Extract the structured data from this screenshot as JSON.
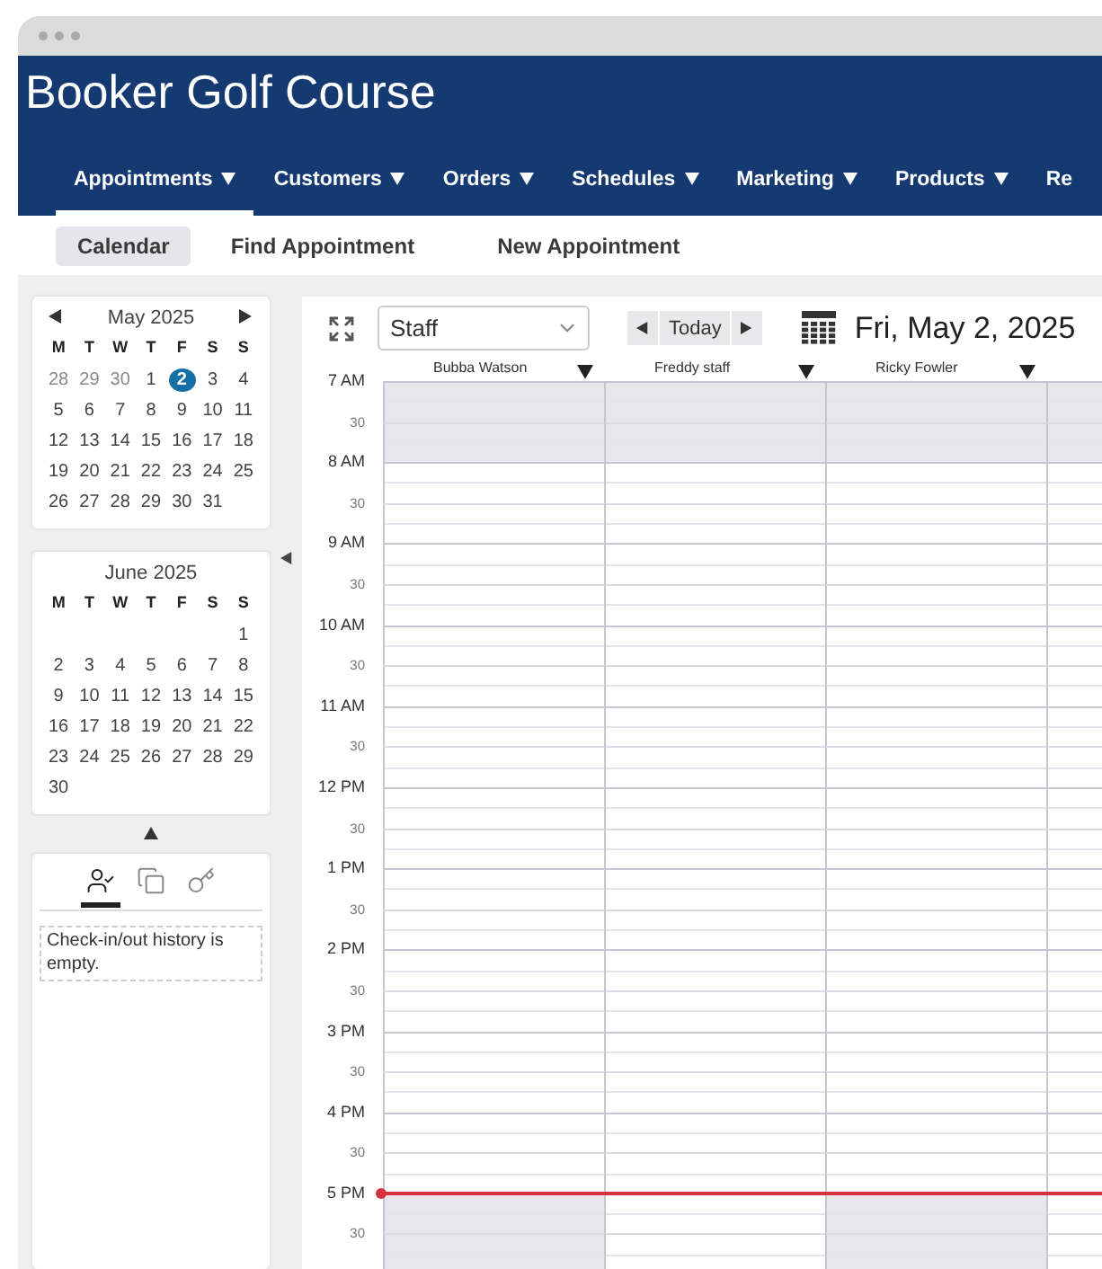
{
  "window": {
    "title": "Booker Golf Course"
  },
  "nav": [
    {
      "label": "Appointments",
      "selected": true
    },
    {
      "label": "Customers",
      "selected": false
    },
    {
      "label": "Orders",
      "selected": false
    },
    {
      "label": "Schedules",
      "selected": false
    },
    {
      "label": "Marketing",
      "selected": false
    },
    {
      "label": "Products",
      "selected": false
    },
    {
      "label": "Re",
      "selected": false
    }
  ],
  "subnav": [
    {
      "label": "Calendar",
      "selected": true
    },
    {
      "label": "Find Appointment",
      "selected": false
    },
    {
      "label": "New Appointment",
      "selected": false
    }
  ],
  "mini_calendars": [
    {
      "title": "May 2025",
      "arrows": true,
      "weekdays": [
        "M",
        "T",
        "W",
        "T",
        "F",
        "S",
        "S"
      ],
      "weeks": [
        [
          {
            "d": "28",
            "muted": true,
            "selected": false
          },
          {
            "d": "29",
            "muted": true,
            "selected": false
          },
          {
            "d": "30",
            "muted": true,
            "selected": false
          },
          {
            "d": "1",
            "muted": false,
            "selected": false
          },
          {
            "d": "2",
            "muted": false,
            "selected": true
          },
          {
            "d": "3",
            "muted": false,
            "selected": false
          },
          {
            "d": "4",
            "muted": false,
            "selected": false
          }
        ],
        [
          {
            "d": "5",
            "muted": false,
            "selected": false
          },
          {
            "d": "6",
            "muted": false,
            "selected": false
          },
          {
            "d": "7",
            "muted": false,
            "selected": false
          },
          {
            "d": "8",
            "muted": false,
            "selected": false
          },
          {
            "d": "9",
            "muted": false,
            "selected": false
          },
          {
            "d": "10",
            "muted": false,
            "selected": false
          },
          {
            "d": "11",
            "muted": false,
            "selected": false
          }
        ],
        [
          {
            "d": "12",
            "muted": false,
            "selected": false
          },
          {
            "d": "13",
            "muted": false,
            "selected": false
          },
          {
            "d": "14",
            "muted": false,
            "selected": false
          },
          {
            "d": "15",
            "muted": false,
            "selected": false
          },
          {
            "d": "16",
            "muted": false,
            "selected": false
          },
          {
            "d": "17",
            "muted": false,
            "selected": false
          },
          {
            "d": "18",
            "muted": false,
            "selected": false
          }
        ],
        [
          {
            "d": "19",
            "muted": false,
            "selected": false
          },
          {
            "d": "20",
            "muted": false,
            "selected": false
          },
          {
            "d": "21",
            "muted": false,
            "selected": false
          },
          {
            "d": "22",
            "muted": false,
            "selected": false
          },
          {
            "d": "23",
            "muted": false,
            "selected": false
          },
          {
            "d": "24",
            "muted": false,
            "selected": false
          },
          {
            "d": "25",
            "muted": false,
            "selected": false
          }
        ],
        [
          {
            "d": "26",
            "muted": false,
            "selected": false
          },
          {
            "d": "27",
            "muted": false,
            "selected": false
          },
          {
            "d": "28",
            "muted": false,
            "selected": false
          },
          {
            "d": "29",
            "muted": false,
            "selected": false
          },
          {
            "d": "30",
            "muted": false,
            "selected": false
          },
          {
            "d": "31",
            "muted": false,
            "selected": false
          }
        ]
      ]
    },
    {
      "title": "June 2025",
      "arrows": false,
      "weekdays": [
        "M",
        "T",
        "W",
        "T",
        "F",
        "S",
        "S"
      ],
      "weeks": [
        [
          {
            "d": "1",
            "muted": false,
            "selected": false
          }
        ],
        [
          {
            "d": "2",
            "muted": false,
            "selected": false
          },
          {
            "d": "3",
            "muted": false,
            "selected": false
          },
          {
            "d": "4",
            "muted": false,
            "selected": false
          },
          {
            "d": "5",
            "muted": false,
            "selected": false
          },
          {
            "d": "6",
            "muted": false,
            "selected": false
          },
          {
            "d": "7",
            "muted": false,
            "selected": false
          },
          {
            "d": "8",
            "muted": false,
            "selected": false
          }
        ],
        [
          {
            "d": "9",
            "muted": false,
            "selected": false
          },
          {
            "d": "10",
            "muted": false,
            "selected": false
          },
          {
            "d": "11",
            "muted": false,
            "selected": false
          },
          {
            "d": "12",
            "muted": false,
            "selected": false
          },
          {
            "d": "13",
            "muted": false,
            "selected": false
          },
          {
            "d": "14",
            "muted": false,
            "selected": false
          },
          {
            "d": "15",
            "muted": false,
            "selected": false
          }
        ],
        [
          {
            "d": "16",
            "muted": false,
            "selected": false
          },
          {
            "d": "17",
            "muted": false,
            "selected": false
          },
          {
            "d": "18",
            "muted": false,
            "selected": false
          },
          {
            "d": "19",
            "muted": false,
            "selected": false
          },
          {
            "d": "20",
            "muted": false,
            "selected": false
          },
          {
            "d": "21",
            "muted": false,
            "selected": false
          },
          {
            "d": "22",
            "muted": false,
            "selected": false
          }
        ],
        [
          {
            "d": "23",
            "muted": false,
            "selected": false
          },
          {
            "d": "24",
            "muted": false,
            "selected": false
          },
          {
            "d": "25",
            "muted": false,
            "selected": false
          },
          {
            "d": "26",
            "muted": false,
            "selected": false
          },
          {
            "d": "27",
            "muted": false,
            "selected": false
          },
          {
            "d": "28",
            "muted": false,
            "selected": false
          },
          {
            "d": "29",
            "muted": false,
            "selected": false
          }
        ],
        [
          {
            "d": "30",
            "muted": false,
            "selected": false
          }
        ]
      ]
    }
  ],
  "history_panel": {
    "tabs": [
      {
        "kind": "checkin",
        "selected": true
      },
      {
        "kind": "copy",
        "selected": false
      },
      {
        "kind": "key",
        "selected": false
      }
    ],
    "message": "Check-in/out history is empty."
  },
  "toolbar": {
    "view_select": {
      "value": "Staff"
    },
    "today_button": "Today",
    "date": "Fri, May 2, 2025"
  },
  "staff": [
    {
      "name": "Bubba Watson"
    },
    {
      "name": "Freddy staff"
    },
    {
      "name": "Ricky Fowler"
    }
  ],
  "time_rows": [
    {
      "label": "7 AM",
      "kind": "hour",
      "current_time": false,
      "off": [
        true,
        true,
        true,
        true
      ]
    },
    {
      "label": "30",
      "kind": "half",
      "current_time": false,
      "off": [
        true,
        true,
        true,
        true
      ]
    },
    {
      "label": "8 AM",
      "kind": "hour",
      "current_time": false,
      "off": [
        false,
        false,
        false,
        false
      ]
    },
    {
      "label": "30",
      "kind": "half",
      "current_time": false,
      "off": [
        false,
        false,
        false,
        false
      ]
    },
    {
      "label": "9 AM",
      "kind": "hour",
      "current_time": false,
      "off": [
        false,
        false,
        false,
        false
      ]
    },
    {
      "label": "30",
      "kind": "half",
      "current_time": false,
      "off": [
        false,
        false,
        false,
        false
      ]
    },
    {
      "label": "10 AM",
      "kind": "hour",
      "current_time": false,
      "off": [
        false,
        false,
        false,
        false
      ]
    },
    {
      "label": "30",
      "kind": "half",
      "current_time": false,
      "off": [
        false,
        false,
        false,
        false
      ]
    },
    {
      "label": "11 AM",
      "kind": "hour",
      "current_time": false,
      "off": [
        false,
        false,
        false,
        false
      ]
    },
    {
      "label": "30",
      "kind": "half",
      "current_time": false,
      "off": [
        false,
        false,
        false,
        false
      ]
    },
    {
      "label": "12 PM",
      "kind": "hour",
      "current_time": false,
      "off": [
        false,
        false,
        false,
        false
      ]
    },
    {
      "label": "30",
      "kind": "half",
      "current_time": false,
      "off": [
        false,
        false,
        false,
        false
      ]
    },
    {
      "label": "1 PM",
      "kind": "hour",
      "current_time": false,
      "off": [
        false,
        false,
        false,
        false
      ]
    },
    {
      "label": "30",
      "kind": "half",
      "current_time": false,
      "off": [
        false,
        false,
        false,
        false
      ]
    },
    {
      "label": "2 PM",
      "kind": "hour",
      "current_time": false,
      "off": [
        false,
        false,
        false,
        false
      ]
    },
    {
      "label": "30",
      "kind": "half",
      "current_time": false,
      "off": [
        false,
        false,
        false,
        false
      ]
    },
    {
      "label": "3 PM",
      "kind": "hour",
      "current_time": false,
      "off": [
        false,
        false,
        false,
        false
      ]
    },
    {
      "label": "30",
      "kind": "half",
      "current_time": false,
      "off": [
        false,
        false,
        false,
        false
      ]
    },
    {
      "label": "4 PM",
      "kind": "hour",
      "current_time": false,
      "off": [
        false,
        false,
        false,
        false
      ]
    },
    {
      "label": "30",
      "kind": "half",
      "current_time": false,
      "off": [
        false,
        false,
        false,
        false
      ]
    },
    {
      "label": "5 PM",
      "kind": "hour",
      "current_time": true,
      "off": [
        true,
        false,
        true,
        false
      ]
    },
    {
      "label": "30",
      "kind": "half",
      "current_time": false,
      "off": [
        true,
        false,
        true,
        false
      ]
    }
  ]
}
